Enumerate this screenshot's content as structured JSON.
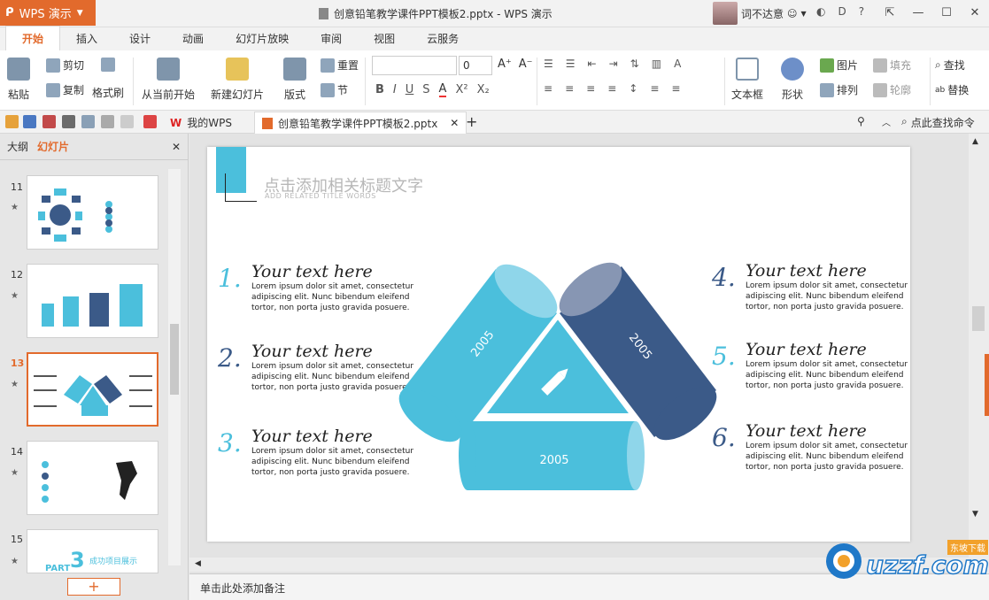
{
  "app": {
    "name": "WPS 演示",
    "doc_title": "创意铅笔教学课件PPT模板2.pptx - WPS 演示",
    "user": "词不达意"
  },
  "tabs": [
    "开始",
    "插入",
    "设计",
    "动画",
    "幻灯片放映",
    "审阅",
    "视图",
    "云服务"
  ],
  "ribbon": {
    "paste": "粘贴",
    "cut": "剪切",
    "copy": "复制",
    "format_painter": "格式刷",
    "from_current": "从当前开始",
    "new_slide": "新建幻灯片",
    "layout": "版式",
    "reset": "重置",
    "section": "节",
    "font_size": "0",
    "textbox": "文本框",
    "shape": "形状",
    "picture": "图片",
    "fill": "填充",
    "arrange": "排列",
    "outline": "轮廓",
    "find": "查找",
    "replace": "替换"
  },
  "quickbar": {
    "tab_wps": "我的WPS",
    "tab_doc": "创意铅笔教学课件PPT模板2.pptx",
    "search": "点此查找命令"
  },
  "left_panel": {
    "tab_outline": "大纲",
    "tab_slides": "幻灯片",
    "slides": [
      {
        "num": "11",
        "selected": false
      },
      {
        "num": "12",
        "selected": false
      },
      {
        "num": "13",
        "selected": true
      },
      {
        "num": "14",
        "selected": false
      },
      {
        "num": "15",
        "selected": false
      }
    ],
    "thumb15_title": "成功项目展示",
    "thumb15_part": "PART",
    "thumb15_number": "3"
  },
  "slide": {
    "title": "点击添加相关标题文字",
    "subtitle": "ADD RELATED TITLE WORDS",
    "items": [
      {
        "num": "1.",
        "head": "Your text here",
        "body": "Lorem ipsum dolor sit amet, consectetur adipiscing elit. Nunc bibendum eleifend tortor, non porta justo gravida posuere.",
        "color": "#4bbfdc"
      },
      {
        "num": "2.",
        "head": "Your text here",
        "body": "Lorem ipsum dolor sit amet, consectetur adipiscing elit. Nunc bibendum eleifend tortor, non porta justo gravida posuere.",
        "color": "#3b5a88"
      },
      {
        "num": "3.",
        "head": "Your text here",
        "body": "Lorem ipsum dolor sit amet, consectetur adipiscing elit. Nunc bibendum eleifend tortor, non porta justo gravida posuere.",
        "color": "#4bbfdc"
      },
      {
        "num": "4.",
        "head": "Your text here",
        "body": "Lorem ipsum dolor sit amet, consectetur adipiscing elit. Nunc bibendum eleifend tortor, non porta justo gravida posuere.",
        "color": "#3b5a88"
      },
      {
        "num": "5.",
        "head": "Your text here",
        "body": "Lorem ipsum dolor sit amet, consectetur adipiscing elit. Nunc bibendum eleifend tortor, non porta justo gravida posuere.",
        "color": "#4bbfdc"
      },
      {
        "num": "6.",
        "head": "Your text here",
        "body": "Lorem ipsum dolor sit amet, consectetur adipiscing elit. Nunc bibendum eleifend tortor, non porta justo gravida posuere.",
        "color": "#3b5a88"
      }
    ],
    "cyl_left": "2005",
    "cyl_right": "2005",
    "cyl_bottom": "2005"
  },
  "notes_placeholder": "单击此处添加备注",
  "watermark": {
    "brand": "uzzf.com",
    "tag": "东坡下载"
  },
  "colors": {
    "accent": "#e26a2c",
    "teal": "#4bbfdc",
    "navy": "#3b5a88"
  }
}
